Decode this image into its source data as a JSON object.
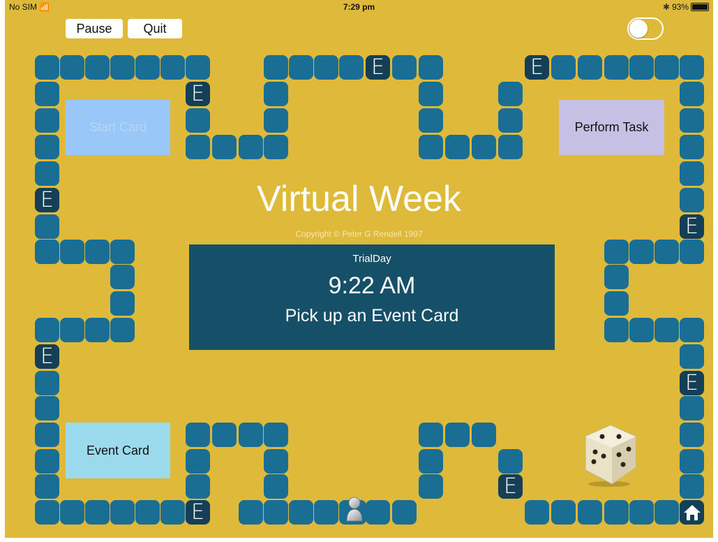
{
  "status_bar": {
    "carrier": "No SIM",
    "time": "7:29 pm",
    "battery": "93%"
  },
  "controls": {
    "pause_label": "Pause",
    "quit_label": "Quit",
    "toggle_on": false
  },
  "cards": {
    "start": "Start Card",
    "perform": "Perform Task",
    "event": "Event Card"
  },
  "title": "Virtual Week",
  "copyright": "Copyright © Peter G Rendell 1997",
  "info": {
    "day": "TrialDay",
    "time": "9:22 AM",
    "message": "Pick up an Event Card"
  },
  "tile_label": "E",
  "colors": {
    "board": "#dfba3a",
    "tile": "#1a6e93",
    "event_tile": "#153f56",
    "info_box": "#165068"
  },
  "icons": {
    "player_token": "person-token-icon",
    "dice": "dice-icon",
    "home": "home-icon"
  }
}
